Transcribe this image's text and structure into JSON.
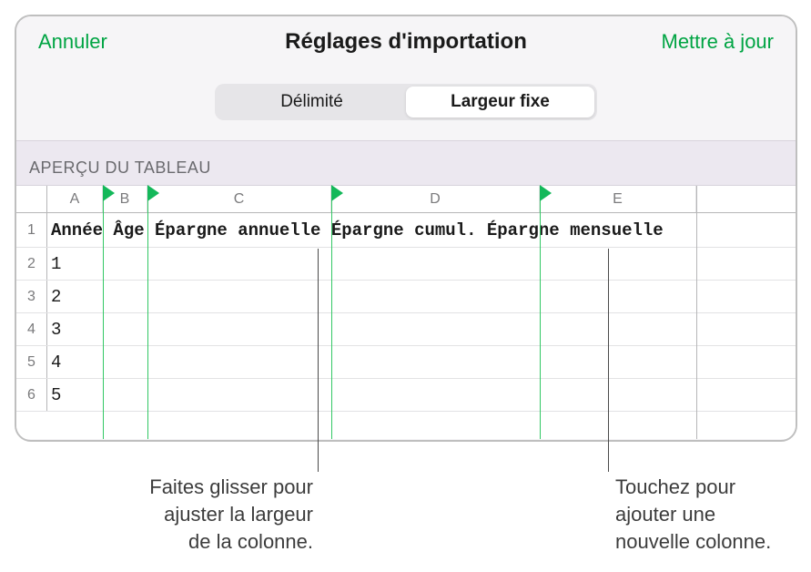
{
  "header": {
    "cancel": "Annuler",
    "title": "Réglages d'importation",
    "update": "Mettre à jour"
  },
  "tabs": {
    "delimited": "Délimité",
    "fixed": "Largeur fixe"
  },
  "section": {
    "preview": "APERÇU DU TABLEAU"
  },
  "columns": {
    "letters": [
      "A",
      "B",
      "C",
      "D",
      "E"
    ],
    "widths": [
      61,
      49,
      202,
      229,
      172
    ]
  },
  "rows": {
    "numbers": [
      "1",
      "2",
      "3",
      "4",
      "5",
      "6"
    ],
    "header_text": "Année Âge Épargne annuelle Épargne cumul. Épargne mensuelle",
    "values": [
      "1",
      "2",
      "3",
      "4",
      "5"
    ]
  },
  "callouts": {
    "left": {
      "line1": "Faites glisser pour",
      "line2": "ajuster la largeur",
      "line3": "de la colonne."
    },
    "right": {
      "line1": "Touchez pour",
      "line2": "ajouter une",
      "line3": "nouvelle colonne."
    }
  }
}
